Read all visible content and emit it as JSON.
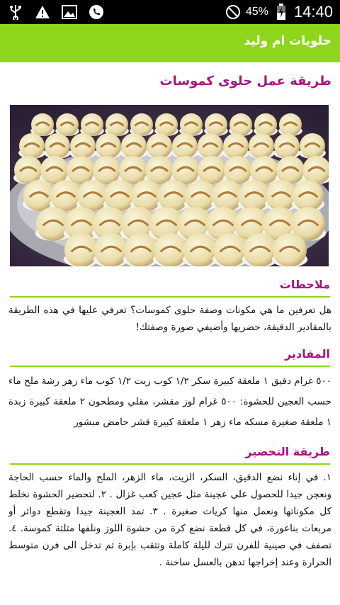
{
  "status_bar": {
    "icons": [
      "usb-icon",
      "warning-icon",
      "image-icon",
      "phone-icon",
      "no-sim-icon",
      "battery-charging-icon"
    ],
    "battery_percent": "45%",
    "time": "14:40"
  },
  "app_bar": {
    "title": "حلويات ام وليد",
    "color": "#8dd61c"
  },
  "recipe": {
    "title": "طريقة عمل حلوى كموسات",
    "title_color": "#a5157f",
    "accent_rule_color": "#8dd61c",
    "notes": {
      "heading": "ملاحظات",
      "text": "هل تعرفين ما هي مكونات وصفة حلوى كموسات؟ تعرفي عليها في هذه الطريقة بالمقادير الدقيقة، حضريها وأضيفي صورة وصفتك!"
    },
    "ingredients": {
      "heading": "المقادير",
      "text": "٥٠٠ غرام دقيق ١ ملعقة كبيرة سكر ١/٢ كوب زيت ١/٢ كوب ماء زهر رشة ملح ماء حسب العجين للحشوة: ٥٠٠ غرام لوز مقشر، مقلي ومطحون ٢ ملعقة كبيرة زبدة ١ ملعقة صغيرة مسكه ماء زهر ١ ملعقة كبيرة قشر حامض مبشور"
    },
    "preparation": {
      "heading": "طريقة التحضير",
      "text": "١. في إناء نضع الدقيق، السكر، الزيت، ماء الزهر، الملح والماء حسب الحاجة ونعجن جيدا للحصول على عجينة مثل عجين كعب غزال . ٢. لتحضير الحشوة نخلط كل مكوناتها ونعمل منها كريات صغيرة . ٣. تمد العجينة جيدا وتقطع دوائر أو مربعات بناعورة، في كل قطعة نضع كرة من حشوة اللوز ونلفها مثلثة كموسة. ٤. تصفف في صينية للفرن تترك لليلة كاملة وتثقب بإبرة ثم تدخل الى فرن متوسط الحرارة وعند إخراجها تدهن بالعسل ساخنة ."
    }
  }
}
